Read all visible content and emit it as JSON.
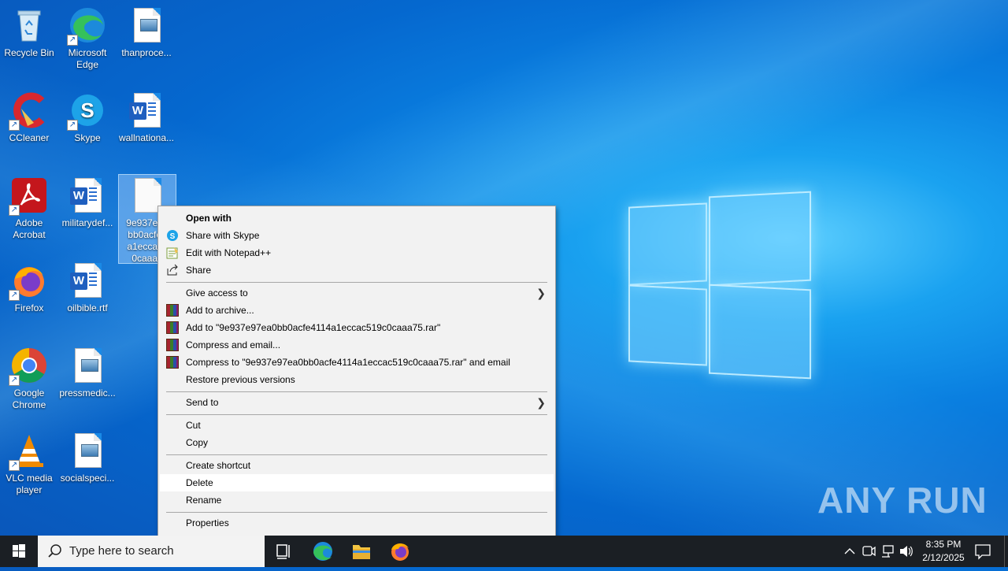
{
  "desktop": {
    "icons": [
      {
        "label": "Recycle Bin"
      },
      {
        "label": "Microsoft Edge"
      },
      {
        "label": "thanproce..."
      },
      {
        "label": "CCleaner"
      },
      {
        "label": "Skype"
      },
      {
        "label": "wallnationa..."
      },
      {
        "label": "Adobe Acrobat"
      },
      {
        "label": "militarydef..."
      },
      {
        "label": "9e937e97 bb0acfe4 a1eccac5 0caaa7"
      },
      {
        "label": "Firefox"
      },
      {
        "label": "oilbible.rtf"
      },
      {
        "label": "Google Chrome"
      },
      {
        "label": "pressmedic..."
      },
      {
        "label": "VLC media player"
      },
      {
        "label": "socialspeci..."
      }
    ]
  },
  "context_menu": {
    "items": [
      {
        "label": "Open with",
        "icon": null
      },
      {
        "label": "Share with Skype",
        "icon": "skype-icon"
      },
      {
        "label": "Edit with Notepad++",
        "icon": "notepadpp-icon"
      },
      {
        "label": "Share",
        "icon": "share-icon"
      },
      {
        "label": "Give access to",
        "icon": null
      },
      {
        "label": "Add to archive...",
        "icon": "winrar-icon"
      },
      {
        "label": "Add to \"9e937e97ea0bb0acfe4114a1eccac519c0caaa75.rar\"",
        "icon": "winrar-icon"
      },
      {
        "label": "Compress and email...",
        "icon": "winrar-icon"
      },
      {
        "label": "Compress to \"9e937e97ea0bb0acfe4114a1eccac519c0caaa75.rar\" and email",
        "icon": "winrar-icon"
      },
      {
        "label": "Restore previous versions",
        "icon": null
      },
      {
        "label": "Send to",
        "icon": null
      },
      {
        "label": "Cut",
        "icon": null
      },
      {
        "label": "Copy",
        "icon": null
      },
      {
        "label": "Create shortcut",
        "icon": null
      },
      {
        "label": "Delete",
        "icon": null
      },
      {
        "label": "Rename",
        "icon": null
      },
      {
        "label": "Properties",
        "icon": null
      }
    ],
    "submenu_arrow": "❯"
  },
  "taskbar": {
    "search_placeholder": "Type here to search",
    "time": "8:35 PM",
    "date": "2/12/2025"
  },
  "watermark": "ANY RUN",
  "colors": {
    "accent": "#0078d7",
    "taskbar": "#1b1f24",
    "menu_bg": "#f2f2f2"
  }
}
